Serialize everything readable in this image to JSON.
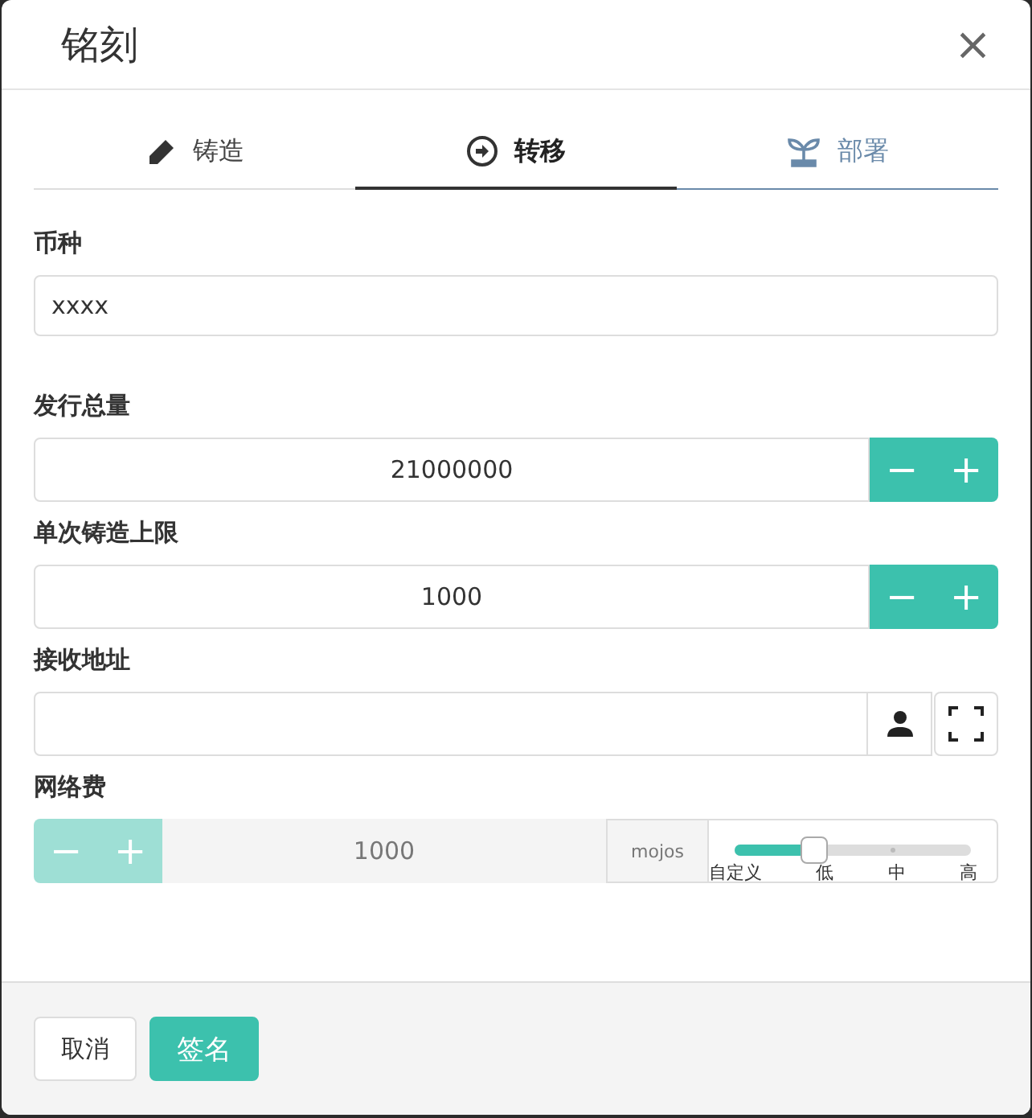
{
  "dialog": {
    "title": "铭刻",
    "close": "×"
  },
  "tabs": [
    {
      "label": "铸造",
      "selected": false,
      "highlighted": false
    },
    {
      "label": "转移",
      "selected": true,
      "highlighted": false
    },
    {
      "label": "部署",
      "selected": false,
      "highlighted": true
    }
  ],
  "fields": [
    {
      "kind": "text",
      "label": "币种",
      "value": "xxxx"
    },
    {
      "kind": "stepper",
      "label": "发行总量",
      "value": "21000000",
      "minus": "−",
      "plus": "+"
    },
    {
      "kind": "stepper",
      "label": "单次铸造上限",
      "value": "1000",
      "minus": "−",
      "plus": "+"
    },
    {
      "kind": "address",
      "label": "接收地址"
    },
    {
      "kind": "fee",
      "label": "网络费",
      "value": "1000",
      "minus": "−",
      "plus": "+",
      "unit": "mojos",
      "disabled": true,
      "level": 0.33,
      "ticks": [
        "自定义",
        "低",
        "中",
        "高"
      ]
    }
  ],
  "buttons": [
    {
      "label": "取消",
      "primary": false
    },
    {
      "label": "签名",
      "primary": true
    }
  ]
}
